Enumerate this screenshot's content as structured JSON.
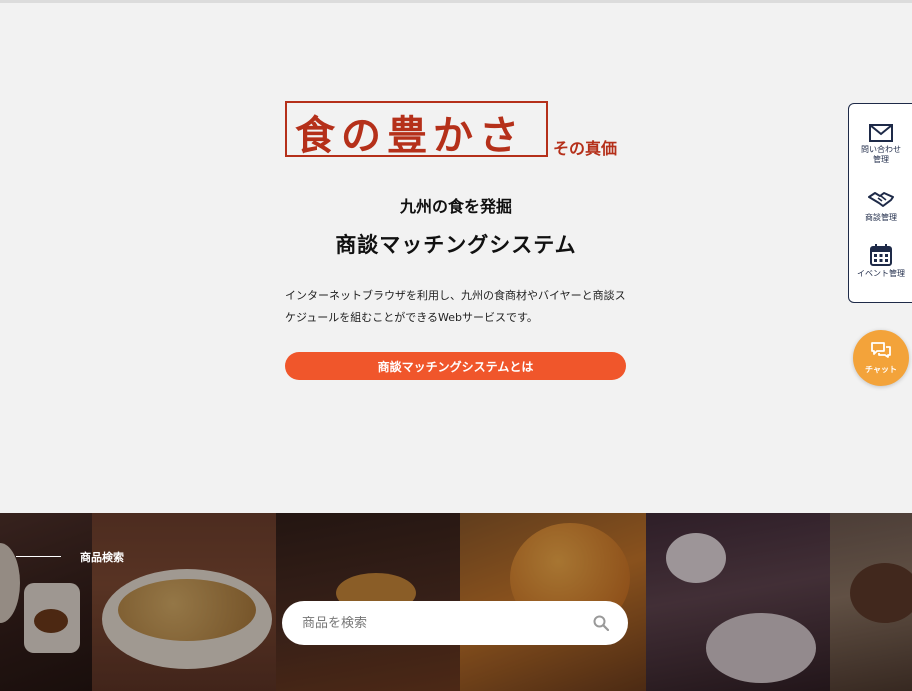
{
  "hero": {
    "logo_text": "食の豊かさ",
    "logo_tagline": "その真価",
    "kicker": "九州の食を発掘",
    "title": "商談マッチングシステム",
    "description": "インターネットブラウザを利用し、九州の食商材やバイヤーと商談スケジュールを組むことができるWebサービスです。",
    "cta_label": "商談マッチングシステムとは"
  },
  "side_panel": {
    "items": [
      {
        "label": "問い合わせ\n管理",
        "icon": "mail-icon"
      },
      {
        "label": "商談管理",
        "icon": "handshake-icon"
      },
      {
        "label": "イベント管理",
        "icon": "calendar-icon"
      }
    ]
  },
  "chat": {
    "label": "チャット",
    "icon": "chat-bubbles-icon"
  },
  "product_search": {
    "section_title": "商品検索",
    "placeholder": "商品を検索",
    "icon": "search-icon"
  },
  "colors": {
    "logo": "#b5301a",
    "cta": "#f0562b",
    "chat": "#f3a33a",
    "panel_border": "#1e2a48"
  }
}
